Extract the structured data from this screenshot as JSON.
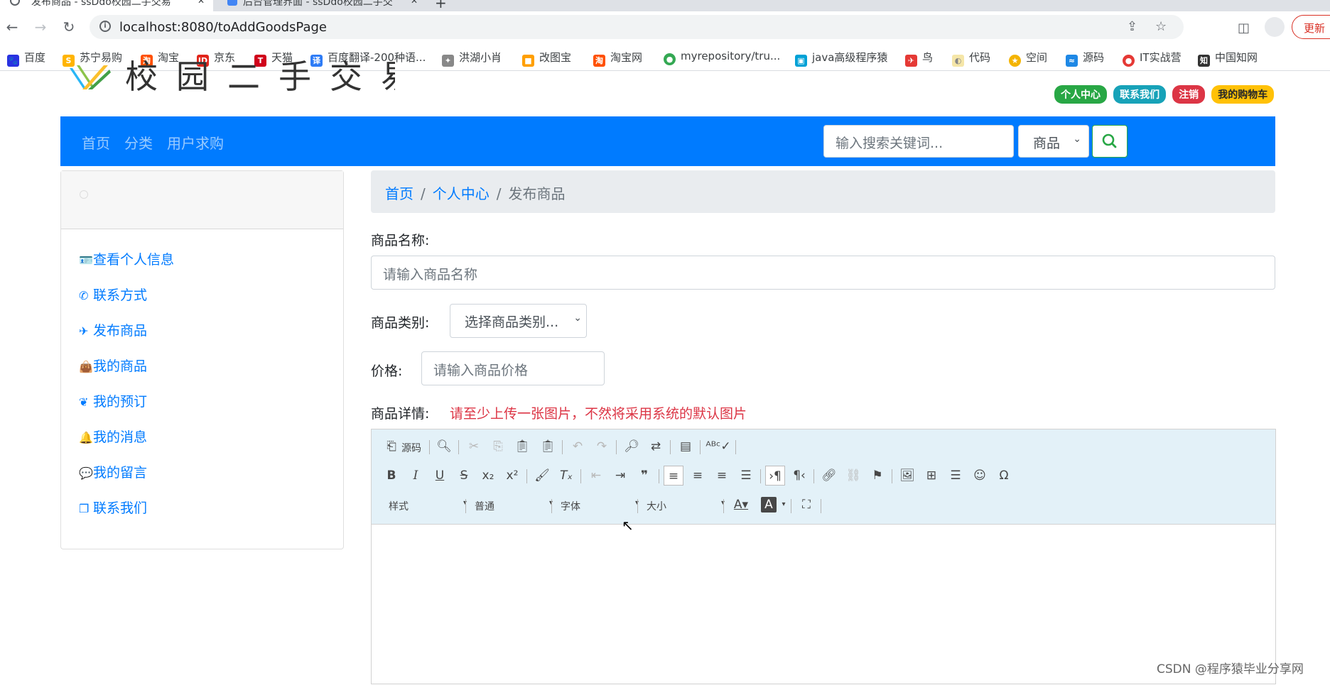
{
  "browser": {
    "tab1_title": "发布商品 - ssDdo校园二手交易",
    "tab2_title": "后台管理界面 - ssDdo校园二手交",
    "url": "localhost:8080/toAddGoodsPage",
    "update_label": "更新",
    "bookmarks": [
      "百度",
      "苏宁易购",
      "淘宝",
      "京东",
      "天猫",
      "百度翻译-200种语...",
      "洪湖小肖",
      "改图宝",
      "淘宝网",
      "myrepository/tru...",
      "java高级程序猿",
      "鸟",
      "代码",
      "空间",
      "源码",
      "IT实战营",
      "中国知网"
    ]
  },
  "header": {
    "logo_text": "校园二手交易平台",
    "badges": [
      {
        "label": "个人中心",
        "color": "#28a745"
      },
      {
        "label": "联系我们",
        "color": "#17a2b8"
      },
      {
        "label": "注销",
        "color": "#dc3545"
      },
      {
        "label": "我的购物车",
        "color": "#ffc107"
      }
    ]
  },
  "navbar": {
    "links": [
      "首页",
      "分类",
      "用户求购"
    ],
    "search_placeholder": "输入搜索关键词...",
    "search_scope": "商品",
    "accent": "#007bff"
  },
  "sidebar": {
    "items": [
      {
        "label": "查看个人信息",
        "icon": "id-card-icon"
      },
      {
        "label": "联系方式",
        "icon": "phone-icon"
      },
      {
        "label": "发布商品",
        "icon": "paper-plane-icon"
      },
      {
        "label": "我的商品",
        "icon": "shopping-bag-icon"
      },
      {
        "label": "我的预订",
        "icon": "leaf-icon"
      },
      {
        "label": "我的消息",
        "icon": "bell-icon"
      },
      {
        "label": "我的留言",
        "icon": "comment-icon"
      },
      {
        "label": "联系我们",
        "icon": "copy-icon"
      }
    ]
  },
  "breadcrumb": {
    "home": "首页",
    "center": "个人中心",
    "current": "发布商品"
  },
  "form": {
    "name_label": "商品名称:",
    "name_placeholder": "请输入商品名称",
    "category_label": "商品类别:",
    "category_value": "选择商品类别...",
    "price_label": "价格:",
    "price_placeholder": "请输入商品价格",
    "detail_label": "商品详情:",
    "detail_warning": "请至少上传一张图片，不然将采用系统的默认图片"
  },
  "editor": {
    "source_label": "源码",
    "combos": [
      "样式",
      "普通",
      "字体",
      "大小"
    ]
  },
  "watermark": "CSDN @程序猿毕业分享网"
}
